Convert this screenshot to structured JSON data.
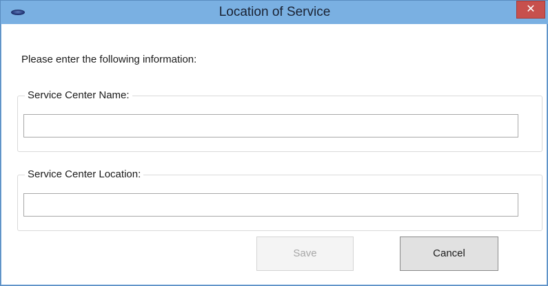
{
  "window": {
    "title": "Location of Service",
    "close_glyph": "✕"
  },
  "form": {
    "instructions": "Please enter the following information:",
    "service_center_name": {
      "label": "Service Center Name:",
      "value": "",
      "placeholder": ""
    },
    "service_center_location": {
      "label": "Service Center Location:",
      "value": "",
      "placeholder": ""
    }
  },
  "buttons": {
    "save_label": "Save",
    "save_enabled": false,
    "cancel_label": "Cancel"
  },
  "icons": {
    "app": "app-logo-icon",
    "close": "close-icon"
  },
  "colors": {
    "titlebar": "#7ab0e2",
    "close_button": "#c7504d",
    "disabled_text": "#a6a6a6"
  }
}
